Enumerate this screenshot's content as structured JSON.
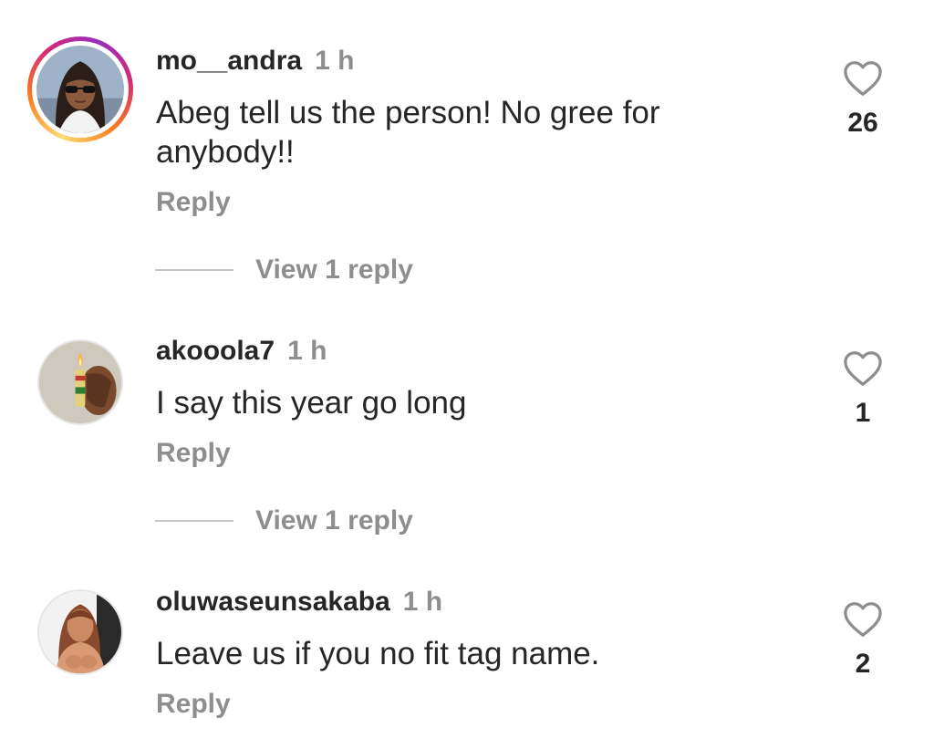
{
  "comments": [
    {
      "username": "mo__andra",
      "time": "1 h",
      "text": "Abeg tell us the person! No gree for anybody!!",
      "reply_label": "Reply",
      "likes": "26",
      "view_replies": "View 1 reply",
      "has_story": true
    },
    {
      "username": "akooola7",
      "time": "1 h",
      "text": "I say this year go long",
      "reply_label": "Reply",
      "likes": "1",
      "view_replies": "View 1 reply",
      "has_story": false
    },
    {
      "username": "oluwaseunsakaba",
      "time": "1 h",
      "text": "Leave us if you no fit tag name.",
      "reply_label": "Reply",
      "likes": "2",
      "has_story": false
    }
  ],
  "colors": {
    "text_primary": "#262626",
    "text_secondary": "#8e8e8e",
    "story_ring": [
      "#feda75",
      "#fa7e1e",
      "#d62976",
      "#962fbf"
    ]
  },
  "icons": {
    "like": "heart-outline-icon"
  }
}
